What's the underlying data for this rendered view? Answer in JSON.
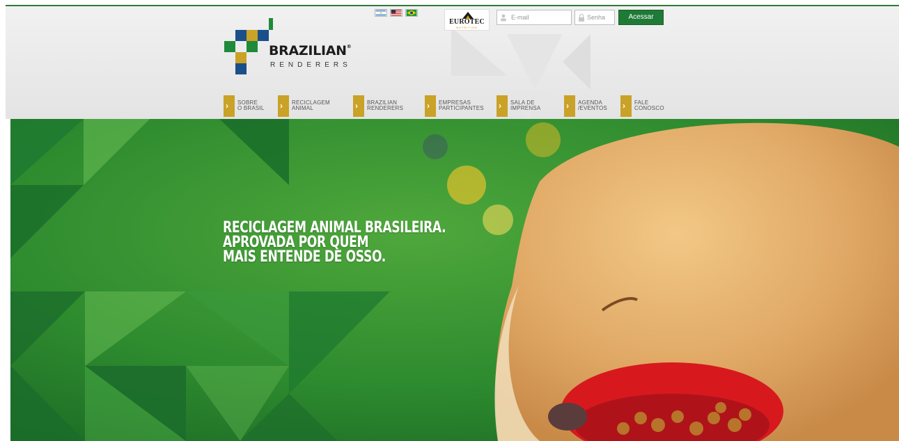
{
  "languages": [
    {
      "name": "Español",
      "flag": "ar-flag-icon"
    },
    {
      "name": "English",
      "flag": "us-flag-icon"
    },
    {
      "name": "Português",
      "flag": "br-flag-icon"
    }
  ],
  "partner": {
    "name": "EUROTEC",
    "tagline": "NUTRITION"
  },
  "login": {
    "email_placeholder": "E-mail",
    "password_placeholder": "Senha",
    "submit_label": "Acessar"
  },
  "logo": {
    "name": "BRAZILIAN",
    "subtitle": "RENDERERS",
    "registered": "®"
  },
  "nav": [
    {
      "label": "SOBRE\nO BRASIL"
    },
    {
      "label": "RECICLAGEM\nANIMAL"
    },
    {
      "label": "BRAZILIAN\nRENDERERS"
    },
    {
      "label": "EMPRESAS\nPARTICIPANTES"
    },
    {
      "label": "SALA DE\nIMPRENSA"
    },
    {
      "label": "AGENDA\n/EVENTOS"
    },
    {
      "label": "FALE\nCONOSCO"
    }
  ],
  "hero": {
    "headline": "RECICLAGEM ANIMAL BRASILEIRA.\nAPROVADA POR QUEM\nMAIS ENTENDE DE OSSO."
  },
  "colors": {
    "brand_green": "#1f7a36",
    "accent_gold": "#c9a227",
    "logo_blue": "#1a4f8a"
  }
}
